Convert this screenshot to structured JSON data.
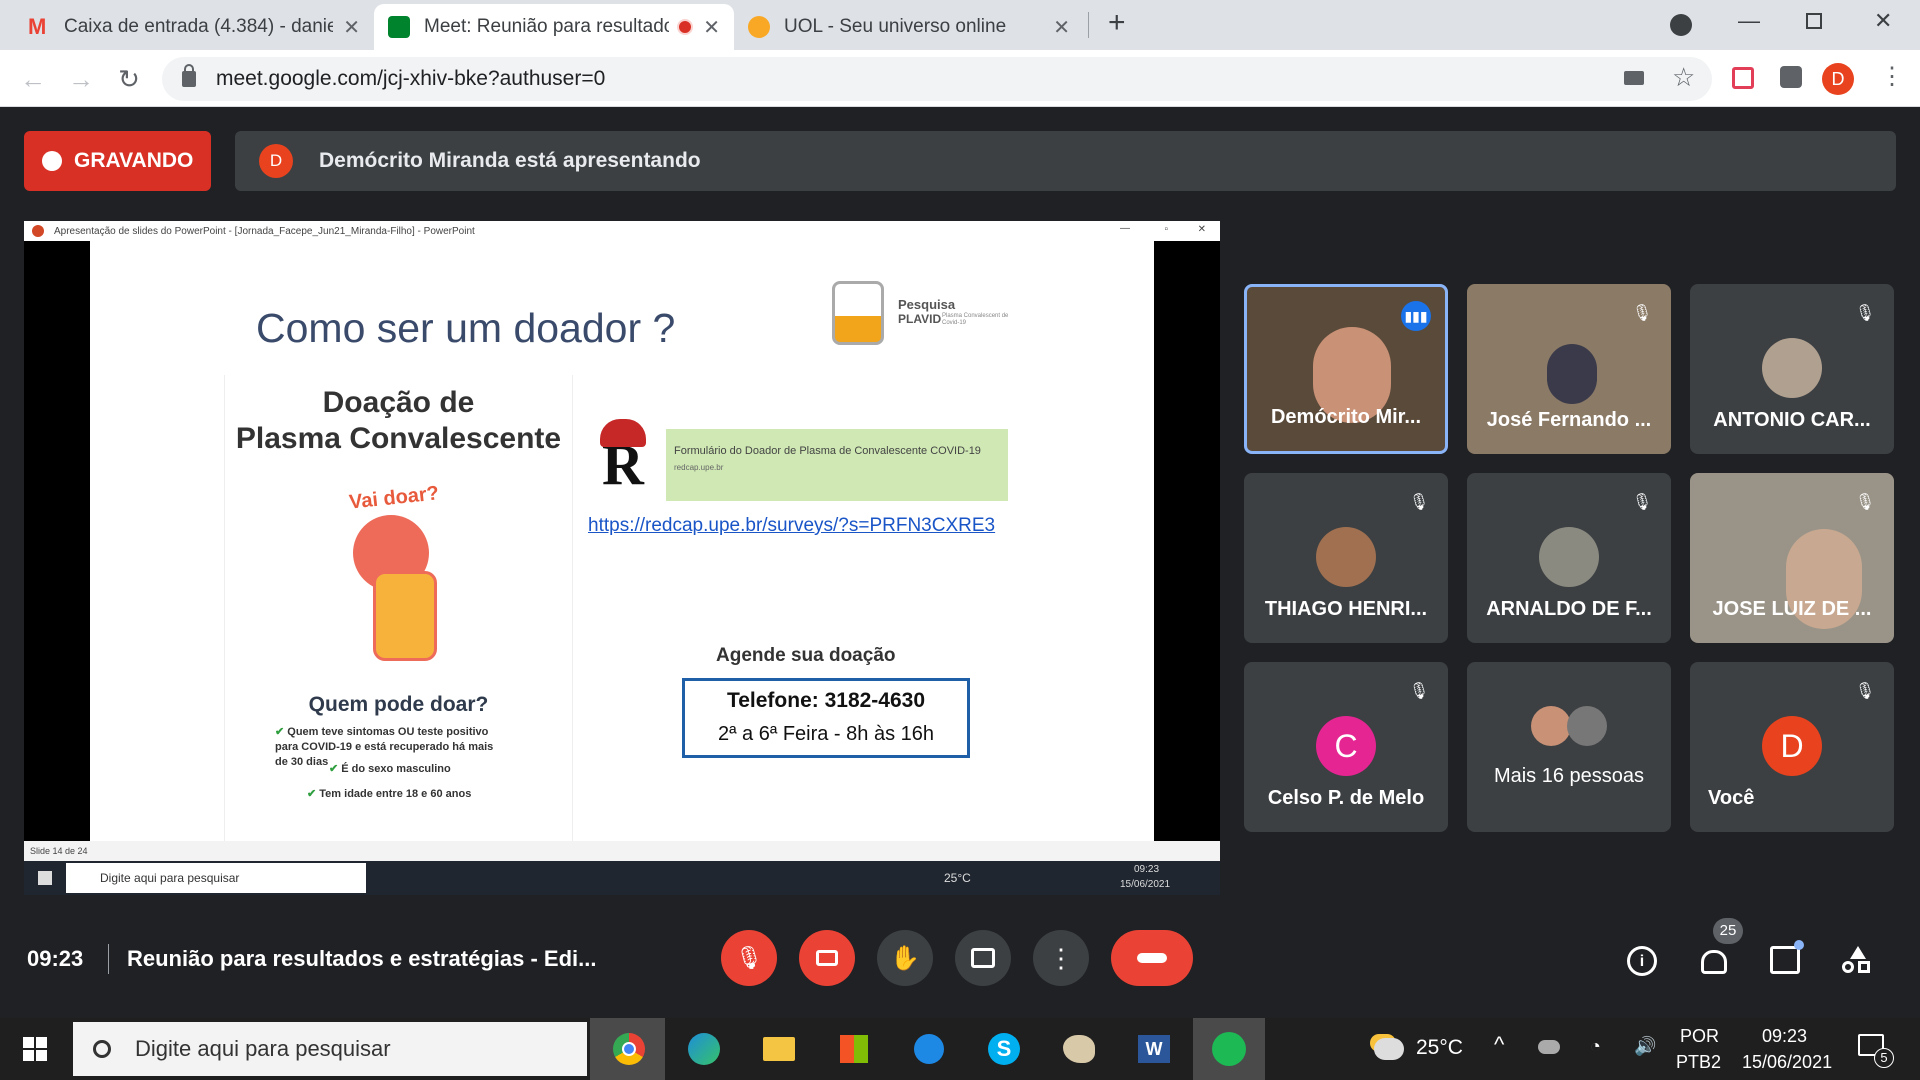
{
  "browser": {
    "tabs": [
      {
        "title": "Caixa de entrada (4.384) - daniel",
        "fav_color": "#ea4335"
      },
      {
        "title": "Meet: Reunião para resultado",
        "fav_color": "#00832d"
      },
      {
        "title": "UOL - Seu universo online",
        "fav_color": "#f9a825"
      }
    ],
    "new_tab": "+",
    "url": "meet.google.com/jcj-xhiv-bke?authuser=0",
    "profile_initial": "D"
  },
  "meet": {
    "recording_label": "GRAVANDO",
    "presenter_initial": "D",
    "presenting_text": "Demócrito Miranda está apresentando",
    "time": "09:23",
    "meeting_title": "Reunião para resultados e estratégias - Edi...",
    "participants_count": "25",
    "chat_badge": "",
    "participants": [
      {
        "name": "Demócrito Mir...",
        "speaking": true
      },
      {
        "name": "José Fernando ...",
        "speaking": false
      },
      {
        "name": "ANTONIO CAR...",
        "speaking": false
      },
      {
        "name": "THIAGO HENRI...",
        "speaking": false
      },
      {
        "name": "ARNALDO DE F...",
        "speaking": false
      },
      {
        "name": "JOSE LUIZ DE ...",
        "speaking": false
      },
      {
        "name": "Celso P. de Melo",
        "initial": "C",
        "color": "#e52592",
        "speaking": false
      },
      {
        "name": "Mais 16 pessoas",
        "speaking": false
      },
      {
        "name": "Você",
        "initial": "D",
        "color": "#e8431e",
        "speaking": false
      }
    ]
  },
  "shared_screen": {
    "window_title": "Apresentação de slides do PowerPoint - [Jornada_Facepe_Jun21_Miranda-Filho] - PowerPoint",
    "slide": {
      "title": "Como ser um doador ?",
      "logo_title": "Pesquisa",
      "logo_name": "PLAVID",
      "logo_sub": "Plasma Convalescent de Covid-19",
      "poster_title_1": "Doação de",
      "poster_title_2": "Plasma Convalescente",
      "vai_doar": "Vai doar?",
      "quem_pode": "Quem pode doar?",
      "criteria": [
        "Quem teve sintomas OU teste positivo para COVID-19 e está recuperado há mais de 30 dias",
        "É do sexo masculino",
        "Tem idade entre 18 e 60 anos"
      ],
      "form_title": "Formulário do Doador de Plasma de Convalescente COVID-19",
      "form_domain": "redcap.upe.br",
      "link": "https://redcap.upe.br/surveys/?s=PRFN3CXRE3",
      "schedule_heading": "Agende sua doação",
      "phone": "Telefone: 3182-4630",
      "hours": "2ª a 6ª Feira - 8h às 16h"
    },
    "status": "Slide 14 de 24",
    "inner_taskbar": {
      "search": "Digite aqui para pesquisar",
      "temp": "25°C",
      "time": "09:23",
      "date": "15/06/2021"
    }
  },
  "taskbar": {
    "search_placeholder": "Digite aqui para pesquisar",
    "temperature": "25°C",
    "lang_1": "POR",
    "lang_2": "PTB2",
    "time": "09:23",
    "date": "15/06/2021",
    "notif": "5"
  }
}
